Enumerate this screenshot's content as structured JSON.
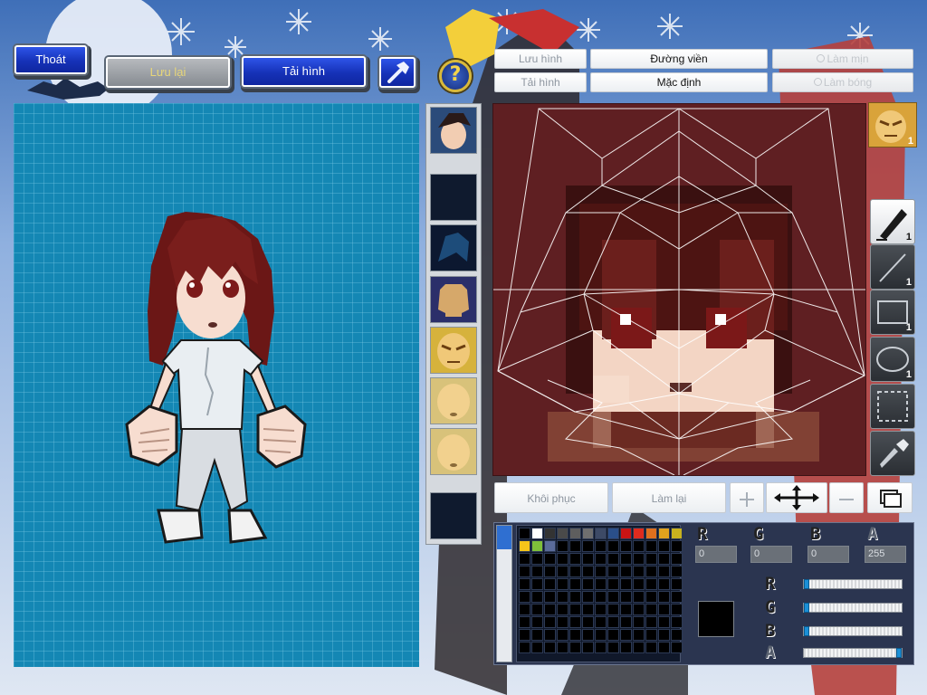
{
  "toolbar": {
    "exit_label": "Thoát",
    "save_label": "Lưu lại",
    "reload_label": "Tải hình",
    "help_glyph": "?",
    "hammer_icon": "hammer-icon"
  },
  "tabs": {
    "save_image": "Lưu hình",
    "outline": "Đường viền",
    "smooth": "Làm mịn",
    "load_image": "Tải hình",
    "default": "Mặc định",
    "shine": "Làm bóng"
  },
  "tools": {
    "pen_count": "1",
    "line_count": "1",
    "rect_count": "1",
    "ellipse_count": "1",
    "face_count": "1"
  },
  "actions": {
    "restore": "Khôi phục",
    "redo": "Làm lại"
  },
  "color": {
    "r_label": "R",
    "g_label": "G",
    "b_label": "B",
    "a_label": "A",
    "r_value": "0",
    "g_value": "0",
    "b_value": "0",
    "a_value": "255",
    "current": "#000000",
    "slider_levels": {
      "r": 0,
      "g": 0,
      "b": 0,
      "a": 1
    }
  },
  "palette": {
    "row1": [
      "#000000",
      "#ffffff",
      "#333333",
      "#4a4a4a",
      "#5e5e5e",
      "#6f6f6f",
      "#3d4a66",
      "#2a4f8a",
      "#c91414",
      "#e02b1e",
      "#e0701e",
      "#e0a21e",
      "#c9b21e"
    ],
    "row2": [
      "#f5c51a",
      "#7fbf3a",
      "#5a6b9a"
    ]
  },
  "colors": {
    "canvas_bg": "#1487b4",
    "editor_bg": "#5f1f22",
    "accent_blue": "#1b3cd0"
  }
}
